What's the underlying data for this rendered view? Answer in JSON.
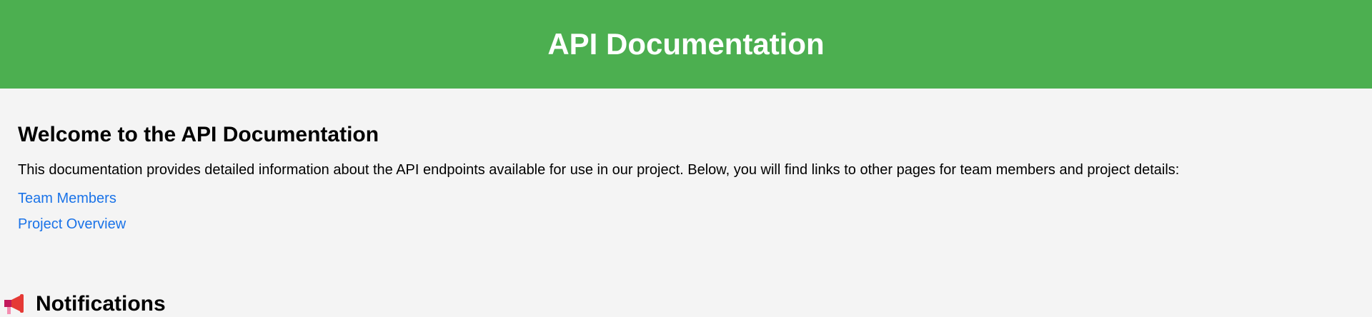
{
  "header": {
    "title": "API Documentation"
  },
  "main": {
    "heading": "Welcome to the API Documentation",
    "intro": "This documentation provides detailed information about the API endpoints available for use in our project. Below, you will find links to other pages for team members and project details:",
    "links": [
      {
        "label": "Team Members"
      },
      {
        "label": "Project Overview"
      }
    ]
  },
  "notifications": {
    "icon": "megaphone-icon",
    "heading": "Notifications"
  },
  "colors": {
    "header_bg": "#4caf50",
    "page_bg": "#f4f4f4",
    "link": "#1a73e8",
    "icon_red": "#e53935"
  }
}
